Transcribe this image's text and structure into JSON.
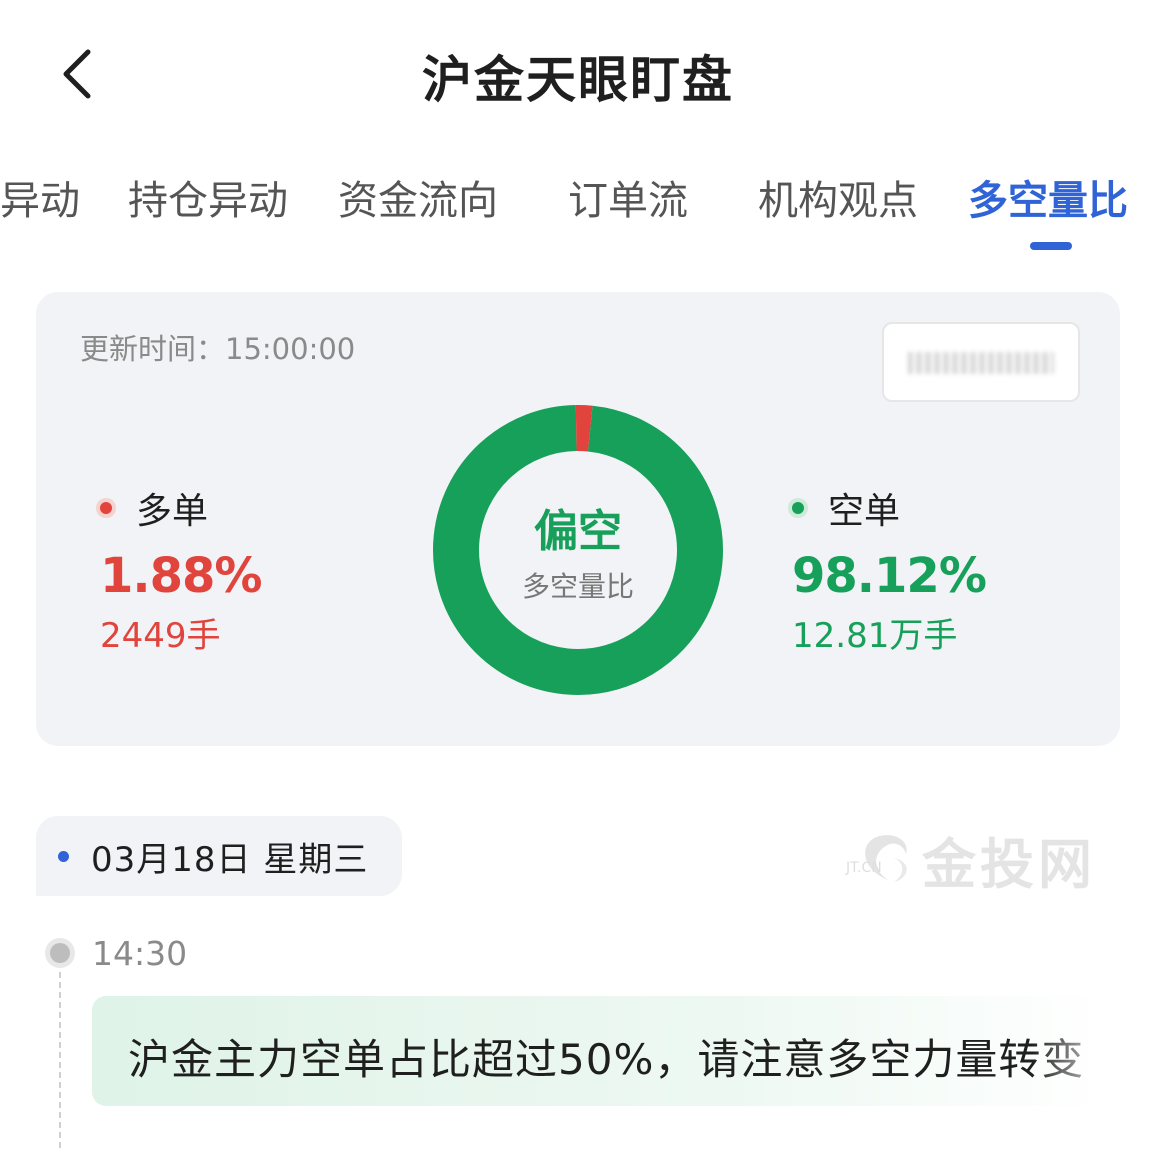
{
  "header": {
    "title": "沪金天眼盯盘"
  },
  "tabs": [
    {
      "label": "异动"
    },
    {
      "label": "持仓异动"
    },
    {
      "label": "资金流向"
    },
    {
      "label": "订单流"
    },
    {
      "label": "机构观点"
    },
    {
      "label": "多空量比",
      "active": true
    }
  ],
  "card": {
    "update_time": "更新时间：15:00:00",
    "long": {
      "label": "多单",
      "percent": "1.88%",
      "lots": "2449手",
      "color": "#e0443c"
    },
    "short": {
      "label": "空单",
      "percent": "98.12%",
      "lots": "12.81万手",
      "color": "#16a05a"
    },
    "donut": {
      "center_main": "偏空",
      "center_sub": "多空量比",
      "long_fraction": 0.0188,
      "short_fraction": 0.9812
    }
  },
  "timeline": {
    "date": "03月18日 星期三",
    "items": [
      {
        "time": "14:30",
        "text": "沪金主力空单占比超过50%，请注意多空力量转变"
      }
    ]
  },
  "watermark": {
    "brand": "金投网",
    "domain": "JT.CN"
  },
  "colors": {
    "accent": "#2f63d6",
    "long": "#e0443c",
    "short": "#16a05a",
    "card_bg": "#f1f3f6"
  }
}
